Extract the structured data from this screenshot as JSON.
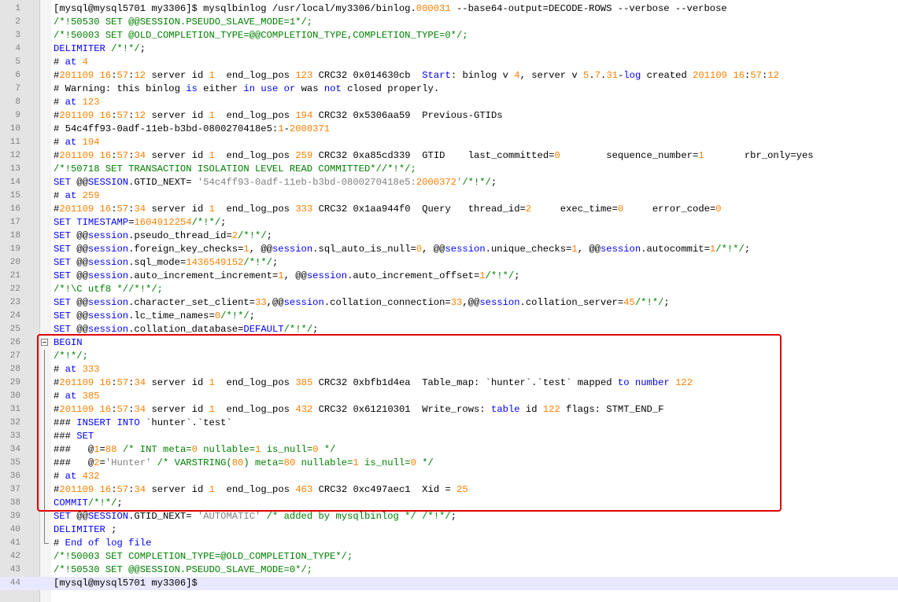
{
  "editor": {
    "lines": [
      {
        "n": "1",
        "text": "[mysql@mysql5701 my3306]$ mysqlbinlog /usr/local/my3306/binlog.000031 --base64-output=DECODE-ROWS --verbose --verbose"
      },
      {
        "n": "2",
        "text": "/*!50530 SET @@SESSION.PSEUDO_SLAVE_MODE=1*/;"
      },
      {
        "n": "3",
        "text": "/*!50003 SET @OLD_COMPLETION_TYPE=@@COMPLETION_TYPE,COMPLETION_TYPE=0*/;"
      },
      {
        "n": "4",
        "text": "DELIMITER /*!*/;"
      },
      {
        "n": "5",
        "text": "# at 4"
      },
      {
        "n": "6",
        "text": "#201109 16:57:12 server id 1  end_log_pos 123 CRC32 0x014630cb  Start: binlog v 4, server v 5.7.31-log created 201109 16:57:12"
      },
      {
        "n": "7",
        "text": "# Warning: this binlog is either in use or was not closed properly."
      },
      {
        "n": "8",
        "text": "# at 123"
      },
      {
        "n": "9",
        "text": "#201109 16:57:12 server id 1  end_log_pos 194 CRC32 0x5306aa59  Previous-GTIDs"
      },
      {
        "n": "10",
        "text": "# 54c4ff93-0adf-11eb-b3bd-0800270418e5:1-2000371"
      },
      {
        "n": "11",
        "text": "# at 194"
      },
      {
        "n": "12",
        "text": "#201109 16:57:34 server id 1  end_log_pos 259 CRC32 0xa85cd339  GTID    last_committed=0        sequence_number=1       rbr_only=yes"
      },
      {
        "n": "13",
        "text": "/*!50718 SET TRANSACTION ISOLATION LEVEL READ COMMITTED*//*!*/;"
      },
      {
        "n": "14",
        "text": "SET @@SESSION.GTID_NEXT= '54c4ff93-0adf-11eb-b3bd-0800270418e5:2000372'/*!*/;"
      },
      {
        "n": "15",
        "text": "# at 259"
      },
      {
        "n": "16",
        "text": "#201109 16:57:34 server id 1  end_log_pos 333 CRC32 0x1aa944f0  Query   thread_id=2     exec_time=0     error_code=0"
      },
      {
        "n": "17",
        "text": "SET TIMESTAMP=1604912254/*!*/;"
      },
      {
        "n": "18",
        "text": "SET @@session.pseudo_thread_id=2/*!*/;"
      },
      {
        "n": "19",
        "text": "SET @@session.foreign_key_checks=1, @@session.sql_auto_is_null=0, @@session.unique_checks=1, @@session.autocommit=1/*!*/;"
      },
      {
        "n": "20",
        "text": "SET @@session.sql_mode=1436549152/*!*/;"
      },
      {
        "n": "21",
        "text": "SET @@session.auto_increment_increment=1, @@session.auto_increment_offset=1/*!*/;"
      },
      {
        "n": "22",
        "text": "/*!\\C utf8 *//*!*/;"
      },
      {
        "n": "23",
        "text": "SET @@session.character_set_client=33,@@session.collation_connection=33,@@session.collation_server=45/*!*/;"
      },
      {
        "n": "24",
        "text": "SET @@session.lc_time_names=0/*!*/;"
      },
      {
        "n": "25",
        "text": "SET @@session.collation_database=DEFAULT/*!*/;"
      },
      {
        "n": "26",
        "text": "BEGIN"
      },
      {
        "n": "27",
        "text": "/*!*/;"
      },
      {
        "n": "28",
        "text": "# at 333"
      },
      {
        "n": "29",
        "text": "#201109 16:57:34 server id 1  end_log_pos 385 CRC32 0xbfb1d4ea  Table_map: `hunter`.`test` mapped to number 122"
      },
      {
        "n": "30",
        "text": "# at 385"
      },
      {
        "n": "31",
        "text": "#201109 16:57:34 server id 1  end_log_pos 432 CRC32 0x61210301  Write_rows: table id 122 flags: STMT_END_F"
      },
      {
        "n": "32",
        "text": "### INSERT INTO `hunter`.`test`"
      },
      {
        "n": "33",
        "text": "### SET"
      },
      {
        "n": "34",
        "text": "###   @1=88 /* INT meta=0 nullable=1 is_null=0 */"
      },
      {
        "n": "35",
        "text": "###   @2='Hunter' /* VARSTRING(80) meta=80 nullable=1 is_null=0 */"
      },
      {
        "n": "36",
        "text": "# at 432"
      },
      {
        "n": "37",
        "text": "#201109 16:57:34 server id 1  end_log_pos 463 CRC32 0xc497aec1  Xid = 25"
      },
      {
        "n": "38",
        "text": "COMMIT/*!*/;"
      },
      {
        "n": "39",
        "text": "SET @@SESSION.GTID_NEXT= 'AUTOMATIC' /* added by mysqlbinlog */ /*!*/;"
      },
      {
        "n": "40",
        "text": "DELIMITER ;"
      },
      {
        "n": "41",
        "text": "# End of log file"
      },
      {
        "n": "42",
        "text": "/*!50003 SET COMPLETION_TYPE=@OLD_COMPLETION_TYPE*/;"
      },
      {
        "n": "43",
        "text": "/*!50530 SET @@SESSION.PSEUDO_SLAVE_MODE=0*/;"
      },
      {
        "n": "44",
        "text": "[mysql@mysql5701 my3306]$"
      }
    ]
  },
  "colors": {
    "keyword": "#0000ff",
    "number": "#ff8000",
    "string": "#808080",
    "comment": "#008000",
    "default": "#000000",
    "highlight_border": "#e00000",
    "current_line": "#e8e8ff"
  }
}
